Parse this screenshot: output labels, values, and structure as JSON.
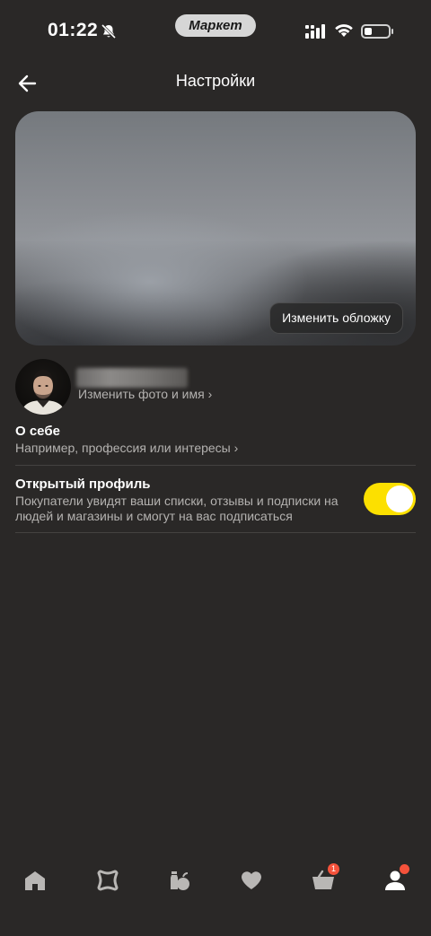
{
  "status_bar": {
    "time": "01:22",
    "app_badge": "Маркет"
  },
  "header": {
    "title": "Настройки"
  },
  "cover": {
    "change_label": "Изменить обложку"
  },
  "profile": {
    "change_photo_label": "Изменить фото и имя ›"
  },
  "about": {
    "title": "О себе",
    "placeholder": "Например, профессия или интересы ›"
  },
  "open_profile": {
    "title": "Открытый профиль",
    "description": "Покупатели увидят ваши списки, отзывы и подписки на людей и магазины и смогут на вас подписаться",
    "enabled": true
  },
  "bottom_nav": {
    "items": [
      {
        "icon": "home-icon"
      },
      {
        "icon": "catalog-icon"
      },
      {
        "icon": "grocery-icon"
      },
      {
        "icon": "heart-icon"
      },
      {
        "icon": "cart-icon",
        "badge": "1"
      },
      {
        "icon": "profile-icon"
      }
    ]
  },
  "colors": {
    "background": "#2a2827",
    "accent": "#fce000",
    "badge": "#f5523b"
  }
}
